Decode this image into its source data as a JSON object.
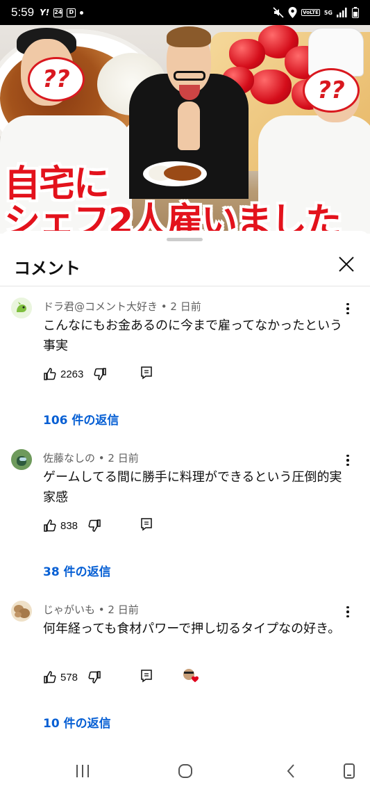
{
  "status_bar": {
    "time": "5:59",
    "left_icons": [
      "yahoo-icon",
      "calendar-24-icon",
      "d-app-icon",
      "dot-icon"
    ],
    "left_icon_text": [
      "Y!",
      "24",
      "D"
    ],
    "right_icons": [
      "mute-icon",
      "location-icon",
      "volte-icon",
      "5g-icon",
      "signal-icon",
      "battery-icon"
    ],
    "volte_label": "VoLTE",
    "network_label": "5G"
  },
  "video": {
    "caption_line1": "自宅に",
    "caption_line2": "シェフ2人雇いました",
    "question_marks": "??"
  },
  "comments_panel": {
    "title": "コメント",
    "comments": [
      {
        "author": "ドラ君@コメント大好き",
        "time": "2 日前",
        "text": "こんなにもお金あるのに今まで雇ってなかったという事実",
        "likes": "2263",
        "replies": "106 件の返信",
        "avatar_color": "#cfe8b6",
        "creator_heart": false
      },
      {
        "author": "佐藤なしの",
        "time": "2 日前",
        "text": "ゲームしてる間に勝手に料理ができるという圧倒的実家感",
        "likes": "838",
        "replies": "38 件の返信",
        "avatar_color": "#7fa36a",
        "creator_heart": false
      },
      {
        "author": "じゃがいも",
        "time": "2 日前",
        "text": "何年経っても食材パワーで押し切るタイプなの好き。",
        "likes": "578",
        "replies": "10 件の返信",
        "avatar_color": "#b58a5a",
        "creator_heart": true
      }
    ]
  },
  "navigation_bar": {
    "buttons": [
      "recents-icon",
      "home-icon",
      "back-icon",
      "rotate-icon"
    ]
  },
  "colors": {
    "reply_link": "#065fd4",
    "caption_red": "#e3121c",
    "meta_gray": "#606060"
  }
}
